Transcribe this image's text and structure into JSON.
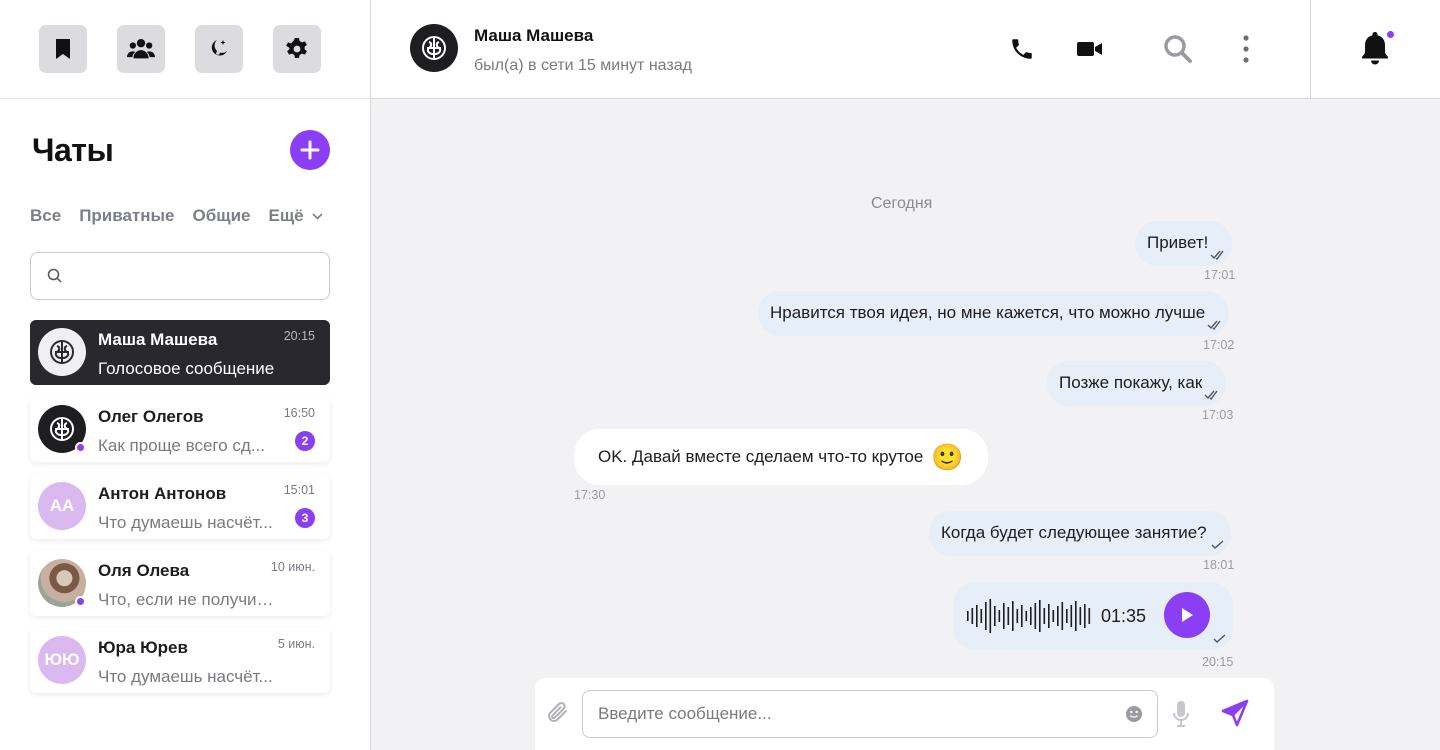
{
  "sidebar": {
    "top_icons": [
      "bookmark-icon",
      "users-icon",
      "night-mode-icon",
      "settings-icon"
    ],
    "title": "Чаты",
    "filters": [
      "Все",
      "Приватные",
      "Общие",
      "Ещё"
    ],
    "search": {
      "placeholder": ""
    },
    "chats": [
      {
        "name": "Маша Машева",
        "message": "Голосовое сообщение",
        "time": "20:15",
        "avatar": "brain-logo",
        "active": true
      },
      {
        "name": "Олег Олегов",
        "message": "Как проще всего сд...",
        "time": "16:50",
        "badge": "2",
        "avatar": "brain-logo",
        "online": true
      },
      {
        "name": "Антон Антонов",
        "message": "Что думаешь насчёт...",
        "time": "15:01",
        "badge": "3",
        "initials": "AA"
      },
      {
        "name": "Оля Олева",
        "message": "Что, если не получит...",
        "time": "10 июн.",
        "avatar": "photo",
        "online": true
      },
      {
        "name": "Юра Юрев",
        "message": "Что думаешь насчёт...",
        "time": "5 июн.",
        "initials": "ЮЮ"
      }
    ]
  },
  "header": {
    "name": "Маша Машева",
    "status": "был(а) в сети 15 минут назад",
    "icons": [
      "phone-icon",
      "video-icon",
      "search-icon",
      "more-icon",
      "bell-icon"
    ]
  },
  "chat": {
    "date_separator": "Сегодня",
    "messages": [
      {
        "direction": "out",
        "text": "Привет!",
        "time": "17:01"
      },
      {
        "direction": "out",
        "text": "Нравится твоя идея, но мне кажется, что можно лучше",
        "time": "17:02"
      },
      {
        "direction": "out",
        "text": "Позже покажу, как",
        "time": "17:03"
      },
      {
        "direction": "in",
        "text": "OK. Давай вместе сделаем что-то крутое",
        "time": "17:30",
        "emoji": "🙂"
      },
      {
        "direction": "out",
        "text": "Когда будет следующее занятие?",
        "time": "18:01"
      },
      {
        "direction": "out",
        "type": "voice",
        "duration": "01:35",
        "time": "20:15"
      }
    ]
  },
  "composer": {
    "placeholder": "Введите сообщение..."
  },
  "colors": {
    "accent": "#8a3ff5",
    "active_chat_bg": "#28282e",
    "outgoing_bubble": "#e6eef8",
    "chat_bg": "#f2f2f4"
  }
}
